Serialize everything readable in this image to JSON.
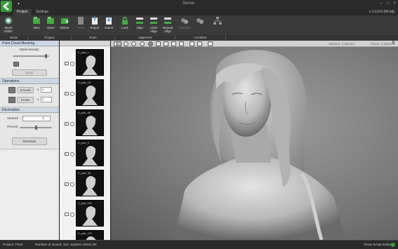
{
  "window": {
    "title": "Sense",
    "version": "v 1.0.0.6 (64 bit)"
  },
  "tabs": [
    {
      "label": "Project"
    },
    {
      "label": "Settings"
    }
  ],
  "ribbon": {
    "buttons": [
      {
        "label": "Mesh\nEditor",
        "icon": "mesh-editor-icon"
      },
      {
        "label": "New",
        "icon": "new-project-icon"
      },
      {
        "label": "Open",
        "icon": "open-folder-icon"
      },
      {
        "label": "Delete",
        "icon": "delete-icon"
      },
      {
        "label": "Scan",
        "icon": "scan-icon"
      },
      {
        "label": "Export",
        "icon": "export-icon"
      },
      {
        "label": "Import",
        "icon": "import-icon"
      },
      {
        "label": "Lock",
        "icon": "lock-icon"
      },
      {
        "label": "Align",
        "icon": "align-icon"
      },
      {
        "label": "Undo\nAlign",
        "icon": "undo-align-icon"
      },
      {
        "label": "Repeat\nAlign",
        "icon": "repeat-align-icon"
      },
      {
        "label": "Combine",
        "icon": "combine-icon"
      },
      {
        "label": "Combine",
        "icon": "combine-all-icon"
      },
      {
        "label": "Hierarchy",
        "icon": "hierarchy-icon"
      }
    ],
    "groups": [
      {
        "label": "Mode"
      },
      {
        "label": "Project"
      },
      {
        "label": "Scan"
      },
      {
        "label": "Alignment"
      },
      {
        "label": "Combine"
      }
    ]
  },
  "left_panel": {
    "meshing": {
      "title": "Point Cloud Meshing",
      "mesh_density_label": "Mesh Density",
      "build_label": "Build"
    },
    "operations": {
      "title": "Operations",
      "smooth_label": "Smooth",
      "smooth_value": "1",
      "erode_label": "Erode",
      "erode_value": "1"
    },
    "decimation": {
      "title": "Decimation",
      "vertices_label": "Vertices",
      "vertices_value": "0",
      "percent_label": "Percent",
      "decimate_label": "Decimate"
    }
  },
  "scans": [
    {
      "name": "0_part_1",
      "checked": true
    },
    {
      "name": "0_part_18",
      "checked": true
    },
    {
      "name": "0_part_55",
      "checked": true
    },
    {
      "name": "0_part_9",
      "checked": true
    },
    {
      "name": "0_part_48",
      "checked": true
    },
    {
      "name": "0_part_101",
      "checked": false
    },
    {
      "name": "0_part_107",
      "checked": false
    }
  ],
  "viewport_toolbar": {
    "vertices": "Vertices: 2,150,847",
    "faces": "Faces: 4,288,878",
    "help": "?"
  },
  "status": {
    "project": "Project: Final",
    "scans": "Number of Scans: 115",
    "system": "System check OK",
    "script": "Show Script Editor"
  },
  "colors": {
    "accent": "#3e9a3e",
    "panel_header": "#cdd7e2",
    "viewport": "#8a8a8a"
  }
}
